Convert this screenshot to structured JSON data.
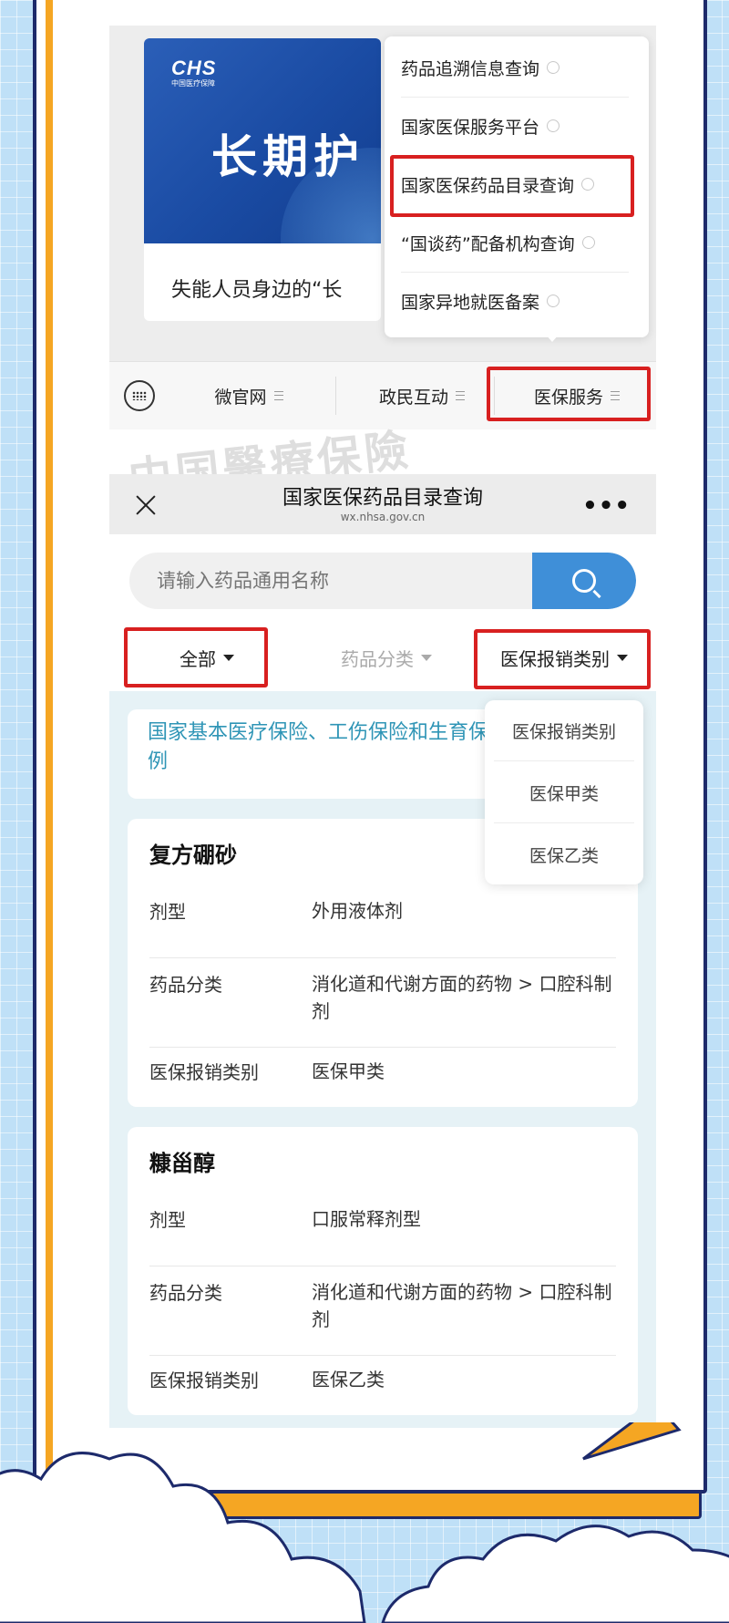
{
  "watermark": "中国醫療保險",
  "article": {
    "logo_mark": "CHS",
    "logo_sub": "中国医疗保障",
    "banner_title": "长期护",
    "caption": "失能人员身边的“长"
  },
  "menu_popup": {
    "items": [
      {
        "label": "药品追溯信息查询"
      },
      {
        "label": "国家医保服务平台"
      },
      {
        "label": "国家医保药品目录查询"
      },
      {
        "label": "“国谈药”配备机构查询"
      },
      {
        "label": "国家异地就医备案"
      }
    ]
  },
  "bottom_bar": {
    "tabs": [
      {
        "label": "微官网"
      },
      {
        "label": "政民互动"
      },
      {
        "label": "医保服务"
      }
    ]
  },
  "mini_program": {
    "title": "国家医保药品目录查询",
    "domain": "wx.nhsa.gov.cn",
    "search": {
      "placeholder": "请输入药品通用名称"
    },
    "filters": [
      {
        "label": "全部"
      },
      {
        "label": "药品分类"
      },
      {
        "label": "医保报销类别"
      }
    ],
    "notice": "国家基本医疗保险、工伤保险和生育保险药品目录凡例",
    "drugs": [
      {
        "name": "复方硼砂",
        "rows": [
          {
            "key": "剂型",
            "value": "外用液体剂"
          },
          {
            "key": "药品分类",
            "value": "消化道和代谢方面的药物 > 口腔科制剂"
          },
          {
            "key": "医保报销类别",
            "value": "医保甲类"
          }
        ]
      },
      {
        "name": "糠甾醇",
        "rows": [
          {
            "key": "剂型",
            "value": "口服常释剂型"
          },
          {
            "key": "药品分类",
            "value": "消化道和代谢方面的药物 > 口腔科制剂"
          },
          {
            "key": "医保报销类别",
            "value": "医保乙类"
          }
        ]
      }
    ],
    "dropdown": {
      "options": [
        {
          "label": "医保报销类别"
        },
        {
          "label": "医保甲类"
        },
        {
          "label": "医保乙类"
        }
      ]
    }
  },
  "colors": {
    "highlight": "#d82020",
    "frame_orange": "#f5a623",
    "frame_navy": "#1d2a6b",
    "link_teal": "#2f95b6",
    "search_blue": "#3f8fd8"
  }
}
